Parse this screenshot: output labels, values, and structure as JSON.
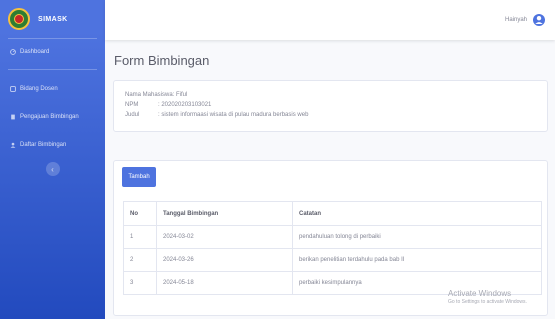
{
  "brand": {
    "name": "SIMASK"
  },
  "sidebar": {
    "items": [
      {
        "label": "Dashboard"
      },
      {
        "label": "Bidang Dosen"
      },
      {
        "label": "Pengajuan Bimbingan"
      },
      {
        "label": "Daftar Bimbingan"
      }
    ],
    "toggle_label": "‹"
  },
  "topbar": {
    "username": "Hainyah"
  },
  "page": {
    "title": "Form Bimbingan"
  },
  "info": {
    "rows": [
      {
        "label": "Nama Mahasiswa",
        "value": ": Fiful"
      },
      {
        "label": "NPM",
        "value": ": 202020203103021"
      },
      {
        "label": "Judul",
        "value": ": sistem informaasi wisata di pulau madura berbasis web"
      }
    ]
  },
  "table": {
    "add_button": "Tambah",
    "headers": [
      "No",
      "Tanggal Bimbingan",
      "Catatan"
    ],
    "rows": [
      [
        "1",
        "2024-03-02",
        "pendahuluan tolong di perbaiki"
      ],
      [
        "2",
        "2024-03-26",
        "berikan penelitian terdahulu pada bab II"
      ],
      [
        "3",
        "2024-05-18",
        "perbaiki kesimpulannya"
      ]
    ]
  },
  "watermark": {
    "title": "Activate Windows",
    "subtitle": "Go to Settings to activate Windows."
  },
  "colors": {
    "primary": "#4e73df",
    "sidebar_dark": "#224abe",
    "background": "#f8f9fc"
  }
}
